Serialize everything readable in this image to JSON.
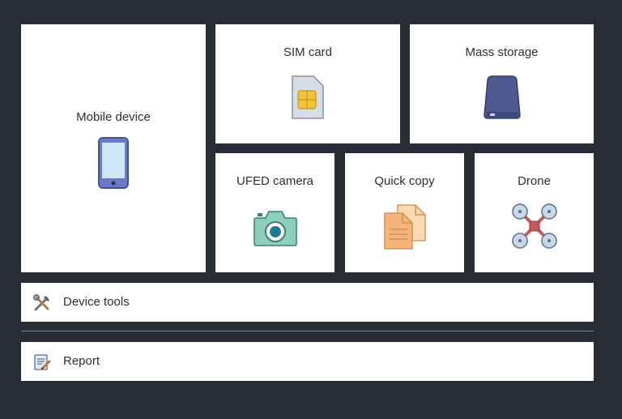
{
  "tiles": {
    "mobile_device": {
      "label": "Mobile device",
      "icon": "smartphone-icon"
    },
    "sim_card": {
      "label": "SIM card",
      "icon": "sim-card-icon"
    },
    "mass_storage": {
      "label": "Mass storage",
      "icon": "hard-drive-icon"
    },
    "ufed_camera": {
      "label": "UFED camera",
      "icon": "camera-icon"
    },
    "quick_copy": {
      "label": "Quick copy",
      "icon": "copy-documents-icon"
    },
    "drone": {
      "label": "Drone",
      "icon": "drone-icon"
    }
  },
  "bars": {
    "device_tools": {
      "label": "Device tools",
      "icon": "tools-icon"
    },
    "report": {
      "label": "Report",
      "icon": "report-icon"
    }
  },
  "colors": {
    "background": "#272c36",
    "tile": "#ffffff",
    "phone": "#6c79c9",
    "sim_chip": "#f5c23c",
    "camera": "#8ccfbf",
    "copy_docs": "#f6c28b",
    "drone_rotor": "#c8d9ea",
    "drone_body": "#c9585a"
  }
}
